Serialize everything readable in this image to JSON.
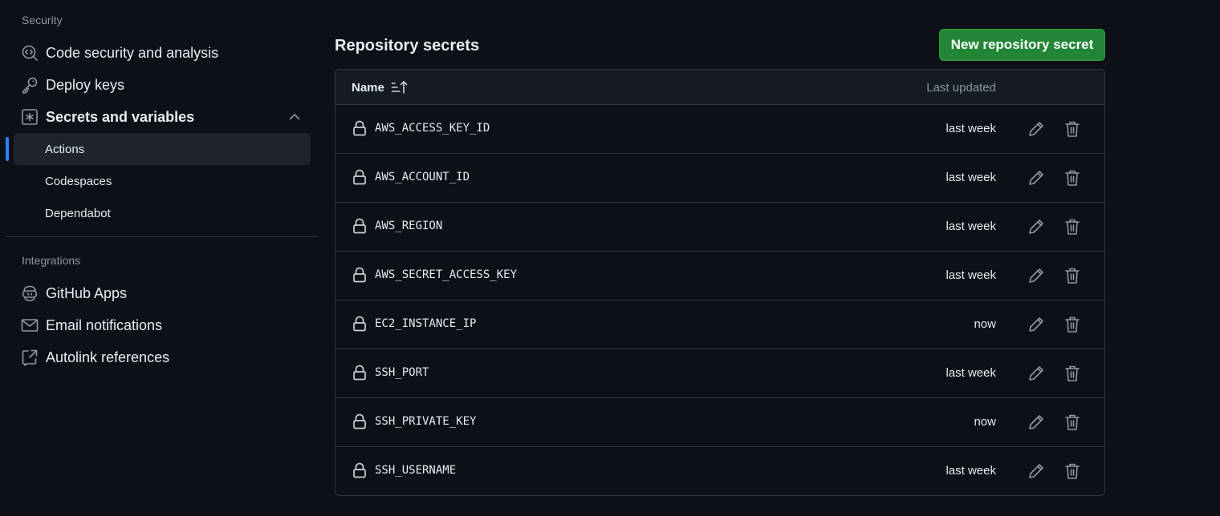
{
  "sidebar": {
    "security_heading": "Security",
    "security_items": [
      {
        "label": "Code security and analysis",
        "icon": "codescan-icon"
      },
      {
        "label": "Deploy keys",
        "icon": "key-icon"
      },
      {
        "label": "Secrets and variables",
        "icon": "asterisk-icon",
        "expanded": true
      }
    ],
    "sub_items": [
      {
        "label": "Actions",
        "active": true
      },
      {
        "label": "Codespaces",
        "active": false
      },
      {
        "label": "Dependabot",
        "active": false
      }
    ],
    "integrations_heading": "Integrations",
    "integration_items": [
      {
        "label": "GitHub Apps",
        "icon": "copilot-icon"
      },
      {
        "label": "Email notifications",
        "icon": "mail-icon"
      },
      {
        "label": "Autolink references",
        "icon": "link-external-icon"
      }
    ]
  },
  "main": {
    "title": "Repository secrets",
    "new_button_label": "New repository secret",
    "table": {
      "col_name": "Name",
      "col_updated": "Last updated",
      "rows": [
        {
          "name": "AWS_ACCESS_KEY_ID",
          "updated": "last week"
        },
        {
          "name": "AWS_ACCOUNT_ID",
          "updated": "last week"
        },
        {
          "name": "AWS_REGION",
          "updated": "last week"
        },
        {
          "name": "AWS_SECRET_ACCESS_KEY",
          "updated": "last week"
        },
        {
          "name": "EC2_INSTANCE_IP",
          "updated": "now"
        },
        {
          "name": "SSH_PORT",
          "updated": "last week"
        },
        {
          "name": "SSH_PRIVATE_KEY",
          "updated": "now"
        },
        {
          "name": "SSH_USERNAME",
          "updated": "last week"
        }
      ]
    }
  },
  "colors": {
    "background": "#0d1117",
    "accent_blue": "#2f81f7",
    "button_green": "#238636",
    "border": "#30363d",
    "muted_text": "#8d96a0"
  }
}
